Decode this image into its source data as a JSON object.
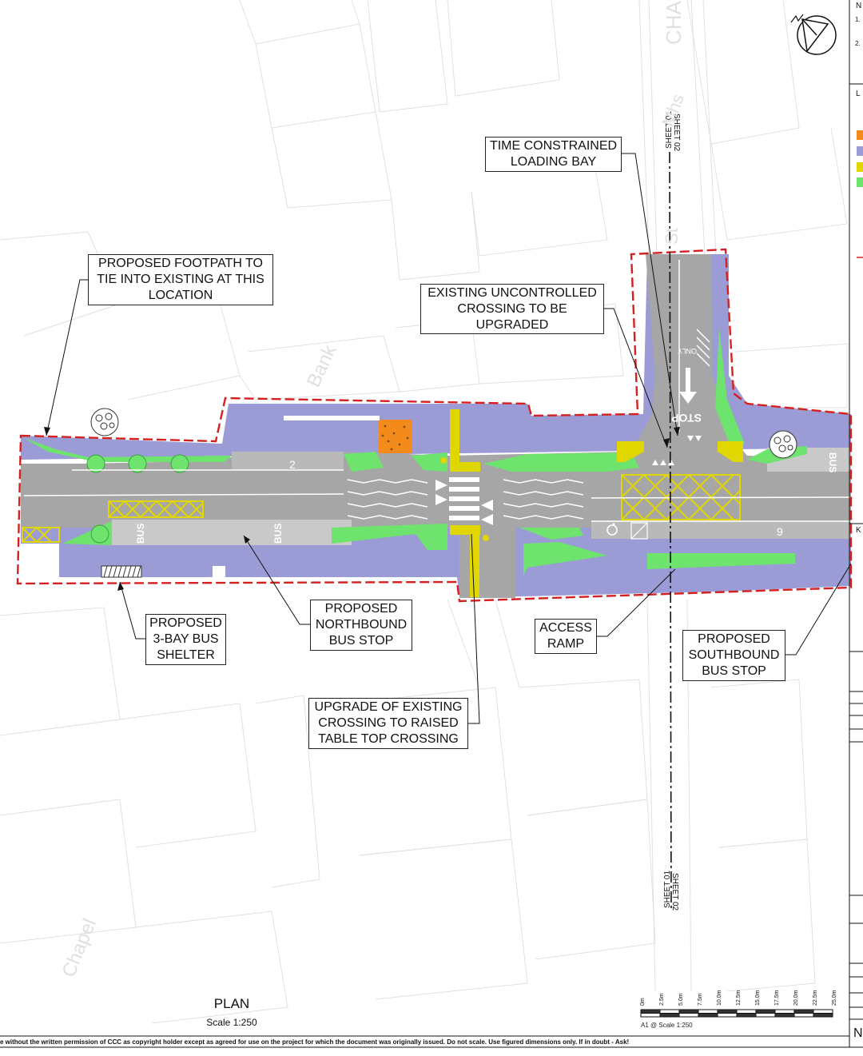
{
  "plan": {
    "title": "PLAN",
    "scale": "Scale 1:250"
  },
  "callouts": {
    "time_loading": "TIME CONSTRAINED\nLOADING BAY",
    "footpath": "PROPOSED FOOTPATH TO\nTIE INTO EXISTING AT THIS\nLOCATION",
    "uncontrolled": "EXISTING UNCONTROLLED\nCROSSING TO BE\nUPGRADED",
    "bus_shelter": "PROPOSED\n3-BAY BUS\nSHELTER",
    "northbound": "PROPOSED\nNORTHBOUND\nBUS STOP",
    "access_ramp": "ACCESS\nRAMP",
    "southbound": "PROPOSED\nSOUTHBOUND\nBUS STOP",
    "raised_crossing": "UPGRADE OF EXISTING\nCROSSING TO RAISED\nTABLE TOP CROSSING"
  },
  "street_names": {
    "bank": "Bank",
    "chapel": "Chapel",
    "cha": "CHA",
    "st": "St",
    "mhs": "Mhs"
  },
  "sheet_marks": {
    "top_01": "SHEET 01",
    "top_02": "SHEET 02",
    "bottom_01": "SHEET 01",
    "bottom_02": "SHEET 02"
  },
  "road_markings": {
    "bus_1": "BUS",
    "bus_2": "BUS",
    "bus_3": "BUS",
    "stop": "STOP",
    "only": "ONLY",
    "bay_2": "2",
    "bay_9": "9"
  },
  "scale_bar": {
    "caption": "A1 @ Scale 1:250",
    "ticks": [
      "0m",
      "2.5m",
      "5.0m",
      "7.5m",
      "10.0m",
      "12.5m",
      "15.0m",
      "17.5m",
      "20.0m",
      "22.5m",
      "25.0m"
    ]
  },
  "footer": "e without the written permission of CCC as copyright holder except as agreed for use on the project for which the document was originally issued. Do not scale.  Use figured dimensions only. If in doubt - Ask!",
  "side_panel": {
    "n": "N",
    "n1": "1.",
    "n2": "2.",
    "l": "L",
    "k": "K",
    "n_bottom": "N"
  },
  "colors": {
    "footway": "#9b9bd6",
    "carriageway": "#a6a6a6",
    "verge": "#6ee36e",
    "tactile": "#e0d700",
    "surfacing": "#f28b1c",
    "boundary": "#d62020"
  }
}
